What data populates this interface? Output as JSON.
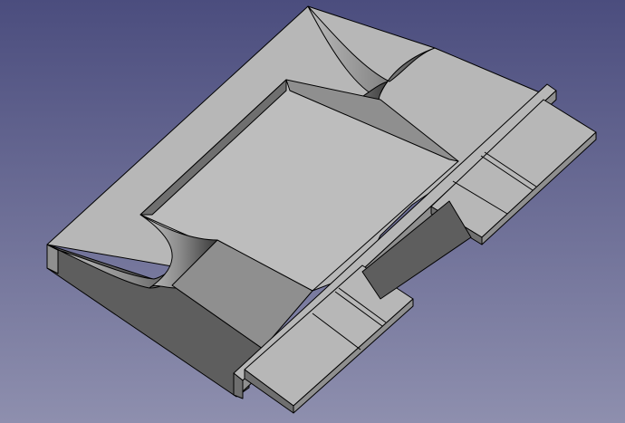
{
  "viewport": {
    "background_top": "#4b4d7e",
    "background_bottom": "#8e8fae"
  },
  "model": {
    "face_light": "#b7b7b7",
    "face_top": "#bdbdbd",
    "face_mid": "#8f8f8f",
    "face_dark": "#6f6f6f",
    "face_shadow": "#5e5e5e",
    "edge_color": "#000000"
  }
}
